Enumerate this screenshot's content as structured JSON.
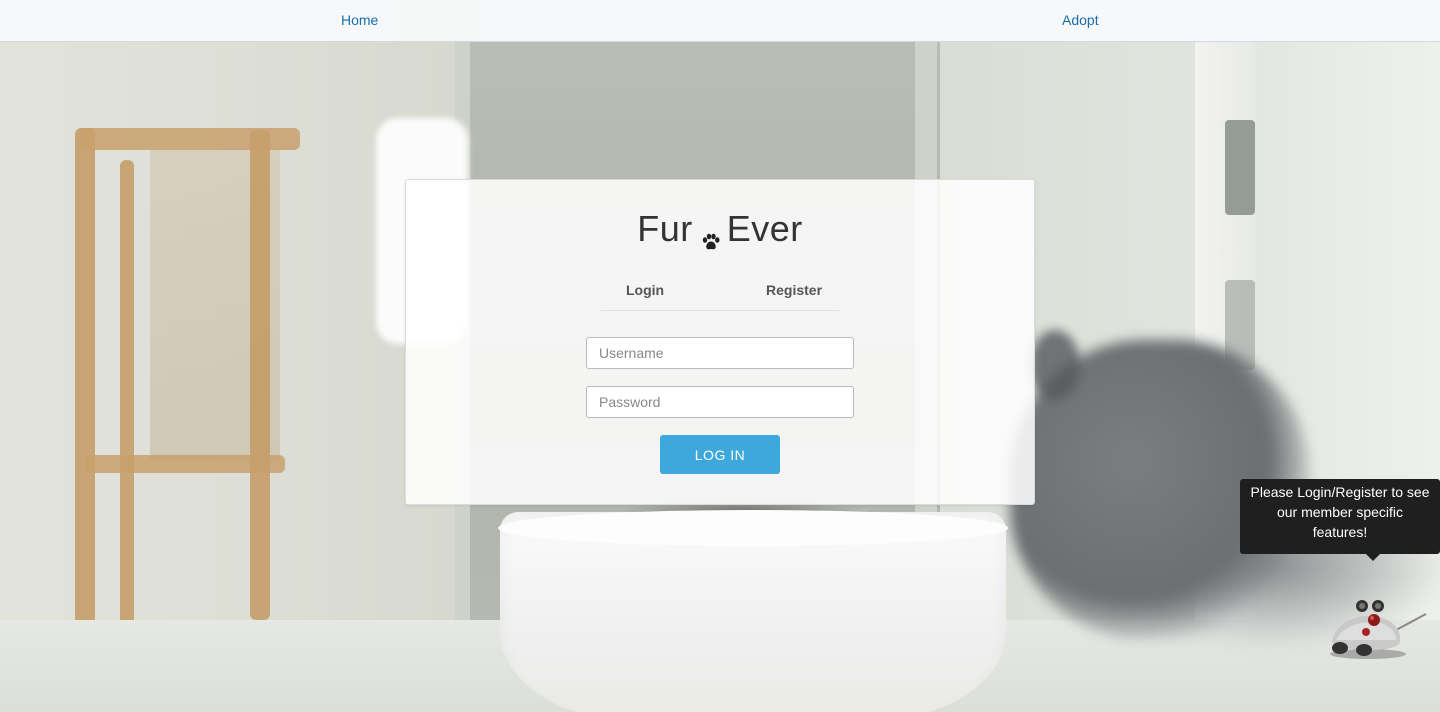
{
  "nav": {
    "home_label": "Home",
    "adopt_label": "Adopt"
  },
  "card": {
    "brand_left": "Fur",
    "brand_icon": "paw-icon",
    "brand_right": "Ever",
    "tabs": [
      {
        "label": "Login",
        "active": true
      },
      {
        "label": "Register",
        "active": false
      }
    ],
    "username": {
      "placeholder": "Username",
      "value": ""
    },
    "password": {
      "placeholder": "Password",
      "value": ""
    },
    "login_button": "LOG IN"
  },
  "tooltip": {
    "text": "Please Login/Register to see our member specific features!"
  },
  "assistant": {
    "icon": "mouse-robot-icon"
  },
  "colors": {
    "link": "#1a6fb0",
    "button": "#3ea8dc",
    "tooltip_bg": "#1f1f1f"
  }
}
